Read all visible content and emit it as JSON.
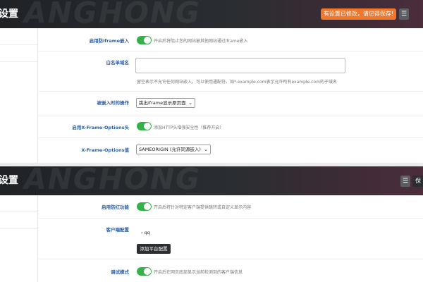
{
  "panel1": {
    "title": "设置",
    "watermark": "ANGHONG",
    "save_notice": "有设置已修改，请记得保存!",
    "menu_icon": "☰",
    "rows": {
      "anti_iframe": {
        "label": "启用防iframe嵌入",
        "help": "开启后将阻止您的网站被其他网站通过iframe嵌入"
      },
      "whitelist": {
        "label": "白名单域名",
        "value": "",
        "help": "留空表示不允许任何网站嵌入，可以使用通配符，如*.example.com表示允许所有example.com的子域名"
      },
      "action": {
        "label": "被嵌入时的操作",
        "value": "跳出iframe显示原页面"
      },
      "xfo_header": {
        "label": "启用X-Frame-Options头",
        "help": "添加HTTP头增强安全性（推荐开启）"
      },
      "xfo_value": {
        "label": "X-Frame-Options值",
        "value": "SAMEORIGIN (允许同源嵌入)"
      }
    }
  },
  "panel2": {
    "title": "设置",
    "watermark": "ANGHONG",
    "menu_icon": "☰",
    "edge_label": "保",
    "rows": {
      "anti_red": {
        "label": "启用防红功能",
        "help": "开启后将针对特定客户端提供跳转或自定义显示内容"
      },
      "client_config": {
        "label": "客户端配置",
        "item": "› qq",
        "add_button": "添加平台配置"
      },
      "debug": {
        "label": "调试模式",
        "help": "开启后在网页底部显示当前检测到的客户端信息"
      }
    }
  },
  "colors": {
    "accent_orange": "#f0782d",
    "toggle_on": "#35b14a",
    "label_blue": "#2b5fa8"
  }
}
